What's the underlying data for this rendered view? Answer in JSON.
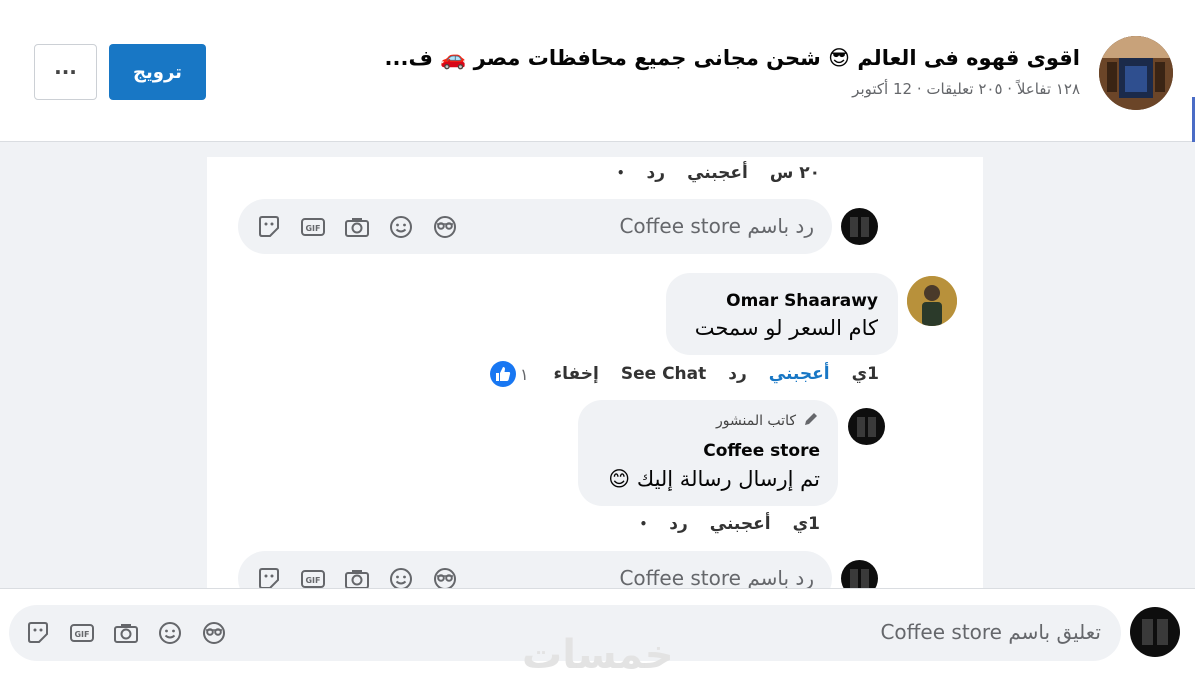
{
  "header": {
    "title": "اقوى قهوه فى العالم 😎 شحن مجانى جميع محافظات مصر 🚗 ف...",
    "meta": "١٢٨ تفاعلاً · ٢٠٥ تعليقات · 12 أكتوبر",
    "promote_label": "ترويج",
    "more_label": "···"
  },
  "thread": {
    "top_actions": {
      "time": "٢٠ س",
      "like": "أعجبني",
      "reply": "رد",
      "dot": "•"
    },
    "reply_box_1": {
      "placeholder": "رد باسم  Coffee store"
    },
    "comment": {
      "author": "Omar Shaarawy",
      "text": "كام السعر لو سمحت",
      "time": "1ي",
      "like": "أعجبني",
      "reply": "رد",
      "see_chat": "See Chat",
      "hide": "إخفاء",
      "like_count": "١"
    },
    "reply": {
      "badge": "كاتب المنشور",
      "author": "Coffee store",
      "text": "تم إرسال رسالة إليك 😊",
      "time": "1ي",
      "like": "أعجبني",
      "reply": "رد",
      "dot": "•"
    },
    "reply_box_2": {
      "placeholder": "رد باسم  Coffee store"
    }
  },
  "footer": {
    "placeholder": "تعليق باسم  Coffee store"
  },
  "watermark": "خمسات",
  "icons": [
    "sticker-icon",
    "gif-icon",
    "camera-icon",
    "emoji-icon",
    "avatar-sticker-icon"
  ],
  "colors": {
    "accent": "#1877c5",
    "like_blue": "#1877f2",
    "bg": "#f0f2f5"
  }
}
